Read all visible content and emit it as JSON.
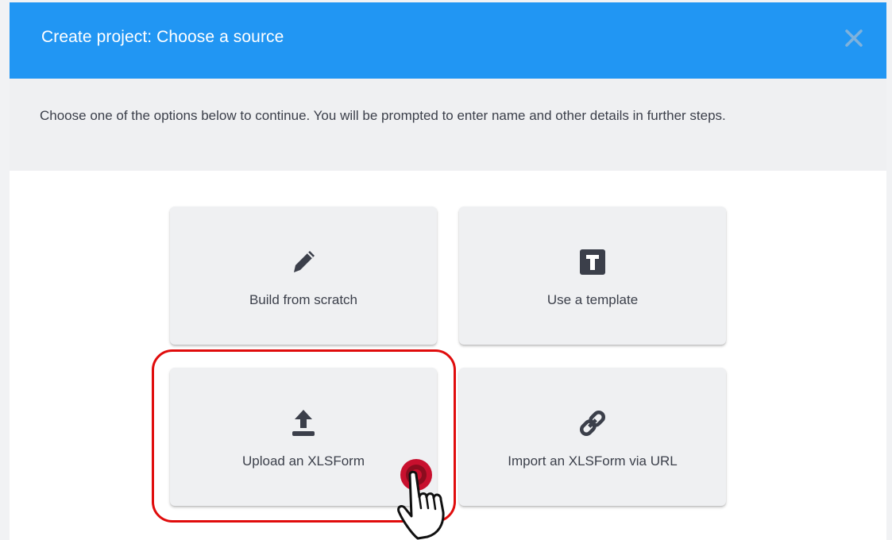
{
  "dialog": {
    "title": "Create project: Choose a source",
    "close_icon": "close-icon",
    "instructions": "Choose one of the options below to continue. You will be prompted to enter name and other details in further steps."
  },
  "options": [
    {
      "label": "Build from scratch",
      "icon": "pencil-icon"
    },
    {
      "label": "Use a template",
      "icon": "template-icon"
    },
    {
      "label": "Upload an XLSForm",
      "icon": "upload-icon"
    },
    {
      "label": "Import an XLSForm via URL",
      "icon": "link-icon"
    }
  ],
  "annotation": {
    "highlight_color": "#e00c0c",
    "pointer_icon": "hand-pointer-icon"
  },
  "colors": {
    "header": "#2196f3",
    "icon": "#3b3f4a",
    "card": "#eff0f2"
  }
}
